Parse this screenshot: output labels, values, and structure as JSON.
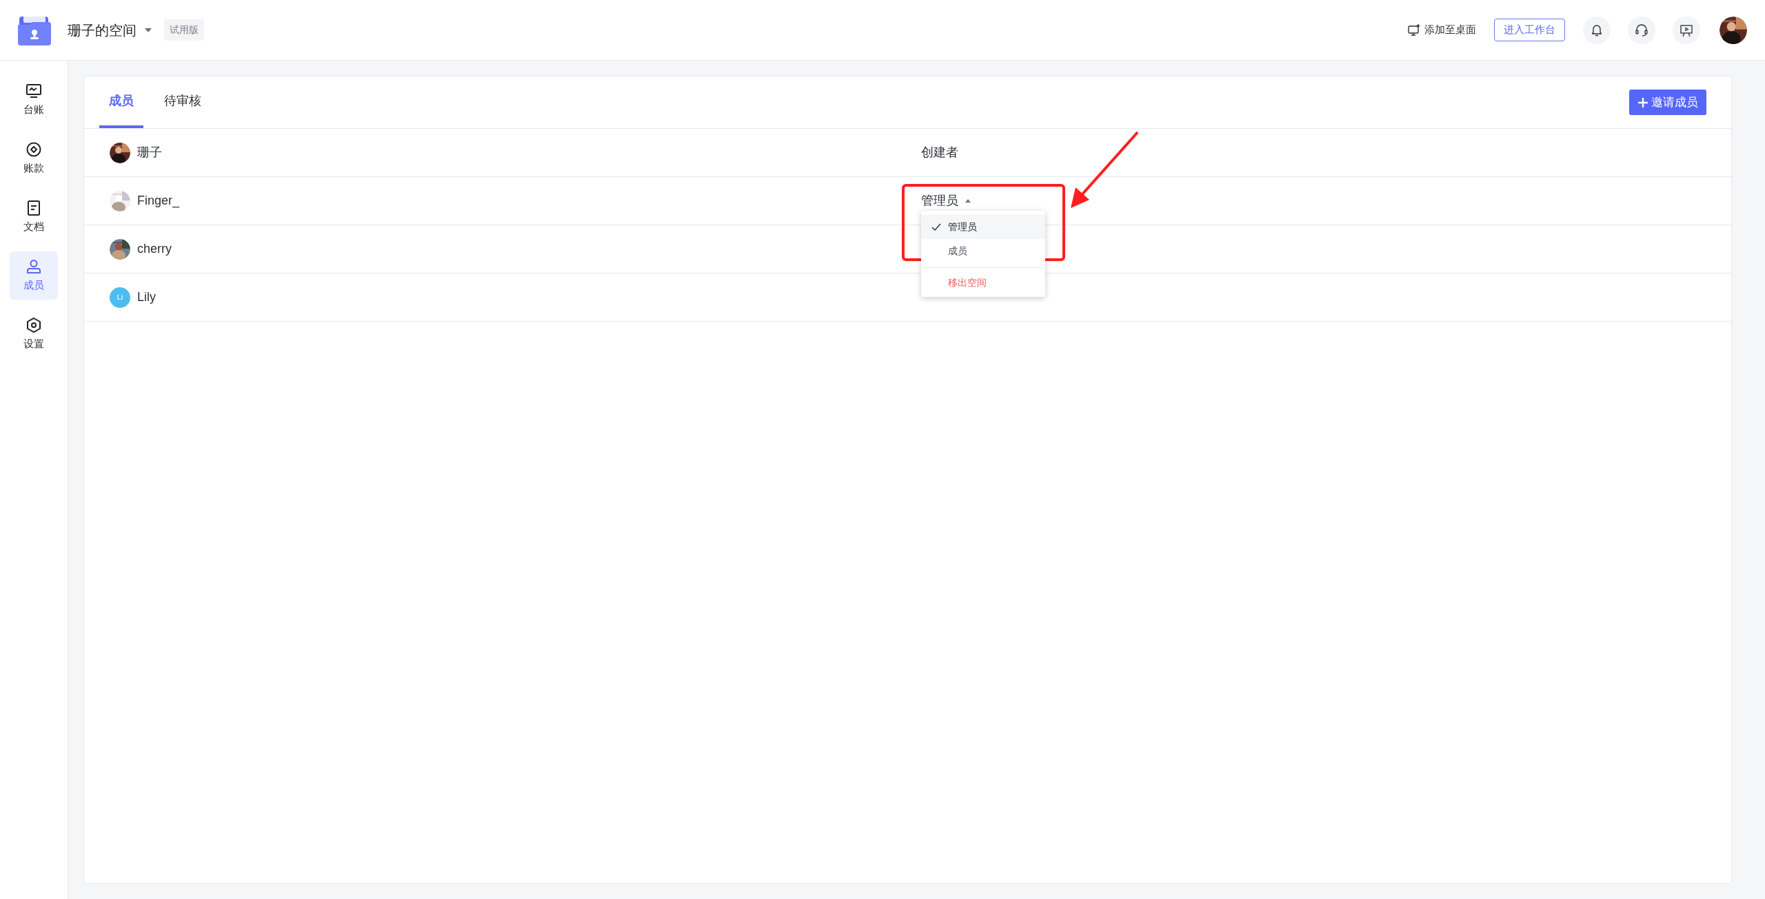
{
  "header": {
    "space_name": "珊子的空间",
    "plan_badge": "试用版",
    "add_to_desktop": "添加至桌面",
    "workbench_button": "进入工作台"
  },
  "sidebar": {
    "items": [
      {
        "label": "台账",
        "kind": "monitor",
        "selected": false
      },
      {
        "label": "账款",
        "kind": "coin",
        "selected": false
      },
      {
        "label": "文档",
        "kind": "document",
        "selected": false
      },
      {
        "label": "成员",
        "kind": "person",
        "selected": true
      },
      {
        "label": "设置",
        "kind": "hexagon",
        "selected": false
      }
    ]
  },
  "tabs": [
    {
      "label": "成员",
      "selected": true
    },
    {
      "label": "待审核",
      "selected": false
    }
  ],
  "invite_button": "邀请成员",
  "members": [
    {
      "name": "珊子",
      "role": {
        "kind": "fixed",
        "text": "创建者"
      }
    },
    {
      "name": "Finger_",
      "role": {
        "kind": "dropdown",
        "text": "管理员",
        "expanded": true
      }
    },
    {
      "name": "cherry"
    },
    {
      "name": "Lily",
      "avatar": {
        "kind": "initials",
        "text": "Li"
      }
    }
  ],
  "role_menu": {
    "options": [
      {
        "label": "管理员",
        "selected": true
      },
      {
        "label": "成员",
        "selected": false
      }
    ],
    "danger_action": "移出空间"
  }
}
